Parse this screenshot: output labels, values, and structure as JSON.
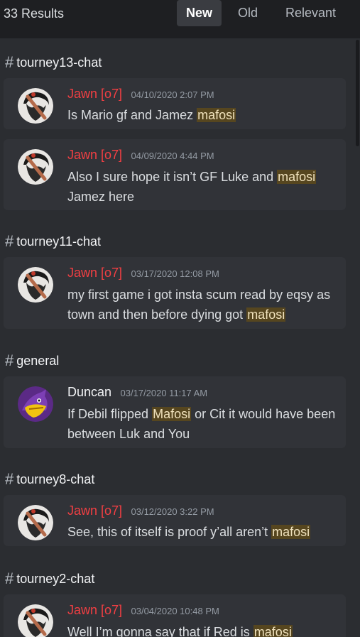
{
  "header": {
    "results_count": "33 Results",
    "tabs": [
      {
        "label": "New",
        "active": true
      },
      {
        "label": "Old",
        "active": false
      },
      {
        "label": "Relevant",
        "active": false
      }
    ]
  },
  "accent_colors": {
    "highlight_bg": "#56461f",
    "author_red": "#f23f43",
    "card_bg": "#313338"
  },
  "results": [
    {
      "channel": "tourney13-chat",
      "messages": [
        {
          "author": "Jawn [o7]",
          "timestamp": "04/10/2020 2:07 PM",
          "avatar": "jawn-avatar",
          "text_before": "Is Mario gf and Jamez ",
          "highlight": "mafosi",
          "text_after": ""
        },
        {
          "author": "Jawn [o7]",
          "timestamp": "04/09/2020 4:44 PM",
          "avatar": "jawn-avatar",
          "text_before": "Also I sure hope it isn’t GF Luke and ",
          "highlight": "mafosi",
          "text_after": " Jamez here"
        }
      ]
    },
    {
      "channel": "tourney11-chat",
      "messages": [
        {
          "author": "Jawn [o7]",
          "timestamp": "03/17/2020 12:08 PM",
          "avatar": "jawn-avatar",
          "text_before": "my first game i got insta scum read by eqsy as town and then before dying got ",
          "highlight": "mafosi",
          "text_after": ""
        }
      ]
    },
    {
      "channel": "general",
      "messages": [
        {
          "author": "Duncan",
          "timestamp": "03/17/2020 11:17 AM",
          "avatar": "duncan-avatar",
          "text_before": "If Debil flipped ",
          "highlight": "Mafosi",
          "text_after": " or Cit it would have been between Luk and You"
        }
      ]
    },
    {
      "channel": "tourney8-chat",
      "messages": [
        {
          "author": "Jawn [o7]",
          "timestamp": "03/12/2020 3:22 PM",
          "avatar": "jawn-avatar",
          "text_before": "See, this of itself is proof y’all aren’t ",
          "highlight": "mafosi",
          "text_after": ""
        }
      ]
    },
    {
      "channel": "tourney2-chat",
      "messages": [
        {
          "author": "Jawn [o7]",
          "timestamp": "03/04/2020 10:48 PM",
          "avatar": "jawn-avatar",
          "text_before": "Well I’m gonna say that if Red is ",
          "highlight": "mafosi",
          "text_after": ""
        }
      ]
    }
  ]
}
